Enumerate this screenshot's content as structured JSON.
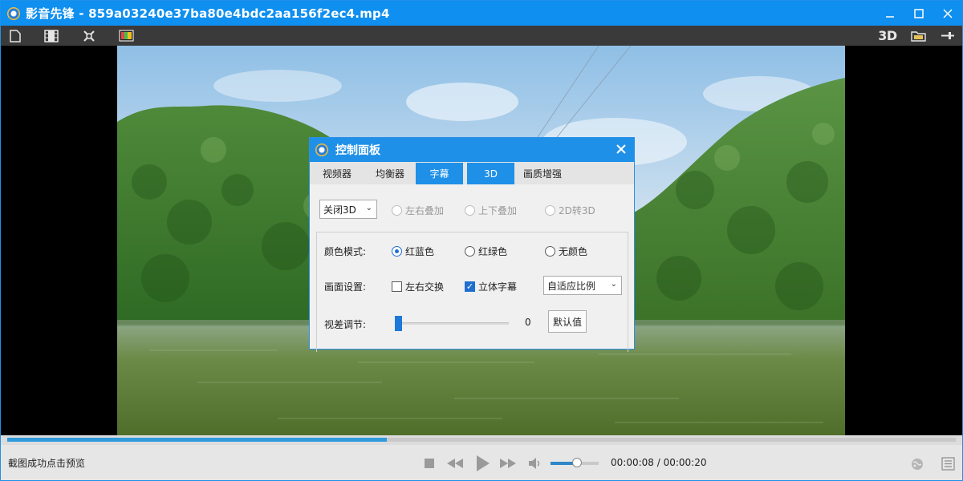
{
  "window": {
    "title": "影音先锋 - 859a03240e37ba80e4bdc2aa156f2ec4.mp4",
    "minimize_icon": "minimize-icon",
    "maximize_icon": "maximize-icon",
    "close_icon": "close-icon"
  },
  "toolbar": {
    "left_icons": [
      "new-file-icon",
      "film-strip-icon",
      "settings-icon",
      "color-palette-icon"
    ],
    "label_3d": "3D",
    "right_icons": [
      "folder-icon",
      "pin-icon"
    ]
  },
  "dialog": {
    "title": "控制面板",
    "tabs": [
      {
        "label": "视频器",
        "active": false
      },
      {
        "label": "均衡器",
        "active": false
      },
      {
        "label": "字幕",
        "active": true
      },
      {
        "label": "3D",
        "active": true
      },
      {
        "label": "画质增强",
        "active": false
      }
    ],
    "mode_select": "关闭3D",
    "modes": [
      "左右叠加",
      "上下叠加",
      "2D转3D"
    ],
    "color_mode": {
      "label": "颜色模式:",
      "options": [
        "红蓝色",
        "红绿色",
        "无颜色"
      ],
      "selected": "红蓝色"
    },
    "picture_setting": {
      "label": "画面设置:",
      "swap_lr": {
        "label": "左右交换",
        "checked": false
      },
      "stereo_subtitle": {
        "label": "立体字幕",
        "checked": true
      },
      "ratio_select": "自适应比例"
    },
    "parallax": {
      "label": "视差调节:",
      "value": "0",
      "default_button": "默认值"
    }
  },
  "playback": {
    "progress_fraction": 0.4,
    "status_text": "截图成功点击预览",
    "time": "00:00:08 / 00:00:20",
    "volume_fraction": 0.55
  },
  "colors": {
    "accent": "#1e90e8",
    "toolbar_bg": "#3a3a3a",
    "progress_fill": "#2f9bdc"
  }
}
